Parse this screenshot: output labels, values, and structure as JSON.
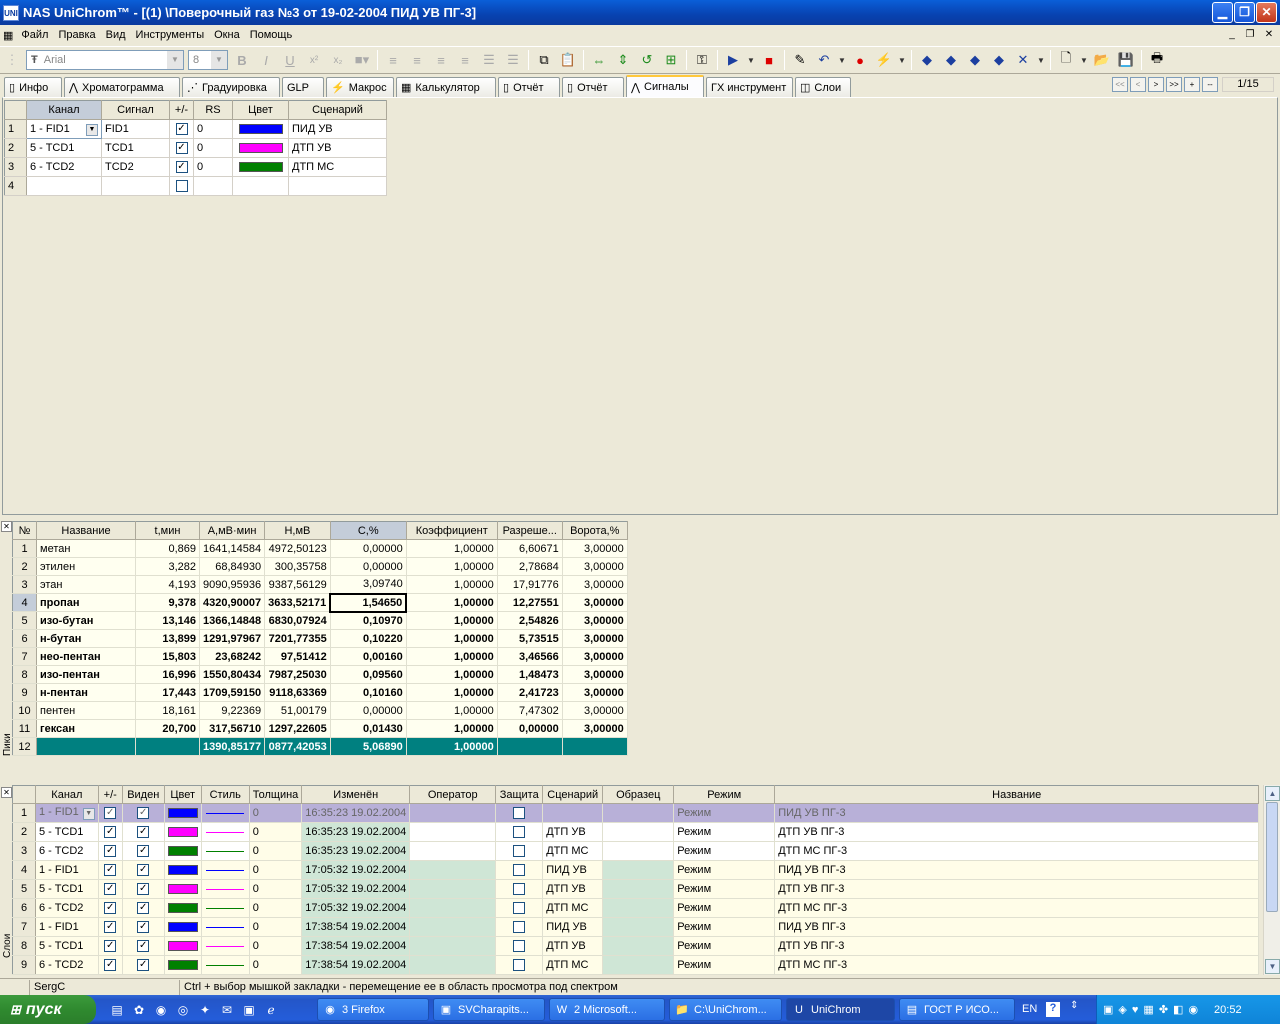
{
  "window": {
    "title": "NAS UniChrom™ - [(1) \\Поверочный газ  №3  от 19-02-2004 ПИД УВ ПГ-3]",
    "app_icon": "UNI"
  },
  "menu": [
    "Файл",
    "Правка",
    "Вид",
    "Инструменты",
    "Окна",
    "Помощь"
  ],
  "toolbar": {
    "font": "Arial",
    "size": "8"
  },
  "tabs": [
    {
      "label": "Инфо",
      "icon": "doc-icon"
    },
    {
      "label": "Хроматограмма",
      "icon": "chromatogram-icon"
    },
    {
      "label": "Градуировка",
      "icon": "calibration-icon"
    },
    {
      "label": "GLP",
      "icon": ""
    },
    {
      "label": "Макрос",
      "icon": "macro-icon"
    },
    {
      "label": "Калькулятор",
      "icon": "calculator-icon"
    },
    {
      "label": "Отчёт",
      "icon": "doc-icon"
    },
    {
      "label": "Отчёт",
      "icon": "doc-icon"
    },
    {
      "label": "Сигналы",
      "icon": "signal-icon"
    },
    {
      "label": "ГХ инструмент",
      "icon": ""
    },
    {
      "label": "Слои",
      "icon": "layers-icon"
    }
  ],
  "active_tab": "Сигналы",
  "nav": {
    "buttons": [
      "<<",
      "<",
      ">",
      ">>",
      "+",
      "--"
    ],
    "page": "1/15"
  },
  "signals": {
    "headers": [
      "Канал",
      "Сигнал",
      "+/-",
      "RS",
      "Цвет",
      "Сценарий"
    ],
    "rows": [
      {
        "n": "1",
        "channel": "1 - FID1",
        "signal": "FID1",
        "checked": true,
        "rs": "0",
        "color": "#0000ff",
        "scenario": "ПИД  УВ"
      },
      {
        "n": "2",
        "channel": "5 - TCD1",
        "signal": "TCD1",
        "checked": true,
        "rs": "0",
        "color": "#ff00ff",
        "scenario": "ДТП  УВ"
      },
      {
        "n": "3",
        "channel": "6 - TCD2",
        "signal": "TCD2",
        "checked": true,
        "rs": "0",
        "color": "#008000",
        "scenario": "ДТП  МС"
      },
      {
        "n": "4",
        "channel": "",
        "signal": "",
        "checked": false,
        "rs": "",
        "color": "",
        "scenario": ""
      }
    ]
  },
  "peaks": {
    "side_label": "Пики",
    "headers": [
      "№",
      "Название",
      "t,мин",
      "A,мВ·мин",
      "H,мВ",
      "C,%",
      "Коэффициент",
      "Разреше...",
      "Ворота,%"
    ],
    "rows": [
      {
        "n": "1",
        "name": "метан",
        "t": "0,869",
        "a": "1641,14584",
        "h": "4972,50123",
        "c": "0,00000",
        "k": "1,00000",
        "r": "6,60671",
        "g": "3,00000",
        "bold": false
      },
      {
        "n": "2",
        "name": "этилен",
        "t": "3,282",
        "a": "68,84930",
        "h": "300,35758",
        "c": "0,00000",
        "k": "1,00000",
        "r": "2,78684",
        "g": "3,00000",
        "bold": false
      },
      {
        "n": "3",
        "name": "этан",
        "t": "4,193",
        "a": "9090,95936",
        "h": "9387,56129",
        "c": "3,09740",
        "k": "1,00000",
        "r": "17,91776",
        "g": "3,00000",
        "bold": false
      },
      {
        "n": "4",
        "name": "пропан",
        "t": "9,378",
        "a": "4320,90007",
        "h": "3633,52171",
        "c": "1,54650",
        "k": "1,00000",
        "r": "12,27551",
        "g": "3,00000",
        "bold": true
      },
      {
        "n": "5",
        "name": "изо-бутан",
        "t": "13,146",
        "a": "1366,14848",
        "h": "6830,07924",
        "c": "0,10970",
        "k": "1,00000",
        "r": "2,54826",
        "g": "3,00000",
        "bold": true
      },
      {
        "n": "6",
        "name": "н-бутан",
        "t": "13,899",
        "a": "1291,97967",
        "h": "7201,77355",
        "c": "0,10220",
        "k": "1,00000",
        "r": "5,73515",
        "g": "3,00000",
        "bold": true
      },
      {
        "n": "7",
        "name": "нео-пентан",
        "t": "15,803",
        "a": "23,68242",
        "h": "97,51412",
        "c": "0,00160",
        "k": "1,00000",
        "r": "3,46566",
        "g": "3,00000",
        "bold": true
      },
      {
        "n": "8",
        "name": "изо-пентан",
        "t": "16,996",
        "a": "1550,80434",
        "h": "7987,25030",
        "c": "0,09560",
        "k": "1,00000",
        "r": "1,48473",
        "g": "3,00000",
        "bold": true
      },
      {
        "n": "9",
        "name": "н-пентан",
        "t": "17,443",
        "a": "1709,59150",
        "h": "9118,63369",
        "c": "0,10160",
        "k": "1,00000",
        "r": "2,41723",
        "g": "3,00000",
        "bold": true
      },
      {
        "n": "10",
        "name": "пентен",
        "t": "18,161",
        "a": "9,22369",
        "h": "51,00179",
        "c": "0,00000",
        "k": "1,00000",
        "r": "7,47302",
        "g": "3,00000",
        "bold": false
      },
      {
        "n": "11",
        "name": "гексан",
        "t": "20,700",
        "a": "317,56710",
        "h": "1297,22605",
        "c": "0,01430",
        "k": "1,00000",
        "r": "0,00000",
        "g": "3,00000",
        "bold": true
      }
    ],
    "total": {
      "n": "12",
      "name": "",
      "t": "",
      "a": "1390,85177",
      "h": "0877,42053",
      "c": "5,06890",
      "k": "1,00000",
      "r": "",
      "g": ""
    }
  },
  "layers": {
    "side_label": "Слои",
    "headers": [
      "Канал",
      "+/-",
      "Виден",
      "Цвет",
      "Стиль",
      "Толщина",
      "Изменён",
      "Оператор",
      "Защита",
      "Сценарий",
      "Образец",
      "Режим",
      "Название"
    ],
    "rows": [
      {
        "n": "1",
        "channel": "1 - FID1",
        "color": "#0000ff",
        "thick": "0",
        "changed": "16:35:23 19.02.2004",
        "scenario": "",
        "mode": "Режим",
        "name": "ПИД УВ ПГ-3"
      },
      {
        "n": "2",
        "channel": "5 - TCD1",
        "color": "#ff00ff",
        "thick": "0",
        "changed": "16:35:23 19.02.2004",
        "scenario": "ДТП  УВ",
        "mode": "Режим",
        "name": "ДТП УВ ПГ-3"
      },
      {
        "n": "3",
        "channel": "6 - TCD2",
        "color": "#008000",
        "thick": "0",
        "changed": "16:35:23 19.02.2004",
        "scenario": "ДТП  МС",
        "mode": "Режим",
        "name": "ДТП МС ПГ-3"
      },
      {
        "n": "4",
        "channel": "1 - FID1",
        "color": "#0000ff",
        "thick": "0",
        "changed": "17:05:32 19.02.2004",
        "scenario": "ПИД  УВ",
        "mode": "Режим",
        "name": "ПИД УВ ПГ-3"
      },
      {
        "n": "5",
        "channel": "5 - TCD1",
        "color": "#ff00ff",
        "thick": "0",
        "changed": "17:05:32 19.02.2004",
        "scenario": "ДТП  УВ",
        "mode": "Режим",
        "name": "ДТП УВ ПГ-3"
      },
      {
        "n": "6",
        "channel": "6 - TCD2",
        "color": "#008000",
        "thick": "0",
        "changed": "17:05:32 19.02.2004",
        "scenario": "ДТП  МС",
        "mode": "Режим",
        "name": "ДТП МС ПГ-3"
      },
      {
        "n": "7",
        "channel": "1 - FID1",
        "color": "#0000ff",
        "thick": "0",
        "changed": "17:38:54 19.02.2004",
        "scenario": "ПИД  УВ",
        "mode": "Режим",
        "name": "ПИД УВ ПГ-3"
      },
      {
        "n": "8",
        "channel": "5 - TCD1",
        "color": "#ff00ff",
        "thick": "0",
        "changed": "17:38:54 19.02.2004",
        "scenario": "ДТП  УВ",
        "mode": "Режим",
        "name": "ДТП УВ ПГ-3"
      },
      {
        "n": "9",
        "channel": "6 - TCD2",
        "color": "#008000",
        "thick": "0",
        "changed": "17:38:54 19.02.2004",
        "scenario": "ДТП  МС",
        "mode": "Режим",
        "name": "ДТП МС ПГ-3"
      }
    ]
  },
  "status": {
    "user": "SergC",
    "hint": "Ctrl + выбор мышкой закладки - перемещение ее в область просмотра под спектром"
  },
  "taskbar": {
    "start": "пуск",
    "tasks": [
      "3 Firefox",
      "SVCharapits...",
      "2 Microsoft...",
      "C:\\UniChrom...",
      "UniChrom",
      "ГОСТ Р ИСО..."
    ],
    "lang": "EN",
    "clock": "20:52"
  }
}
